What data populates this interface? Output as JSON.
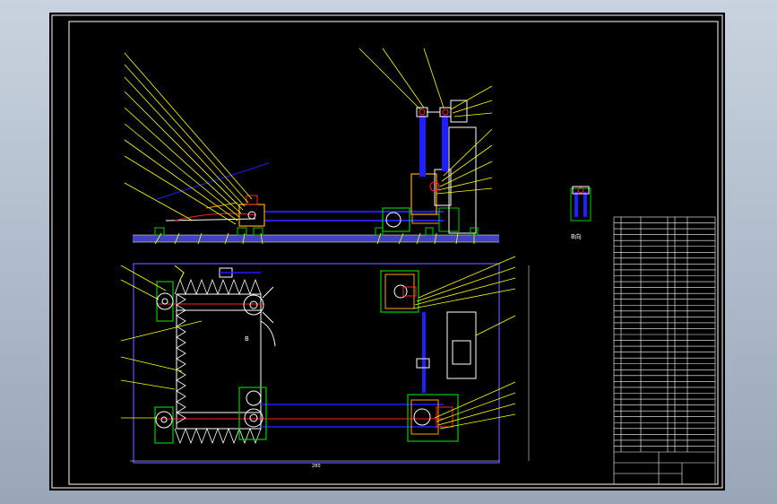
{
  "viewport": {
    "background": "#000000",
    "workspace_background": "#a9b6c6"
  },
  "drawing": {
    "colors": {
      "frame": "#ffffff",
      "leader": "#ffff00",
      "base": "#5a5aff",
      "chain": "#ff2222",
      "guard": "#00cc00",
      "part": "#ffa500",
      "shaft": "#1e1eff"
    },
    "section_label": "B",
    "view_label": "B向",
    "dimension_label": "280",
    "title_block": {
      "rows": 40
    }
  }
}
